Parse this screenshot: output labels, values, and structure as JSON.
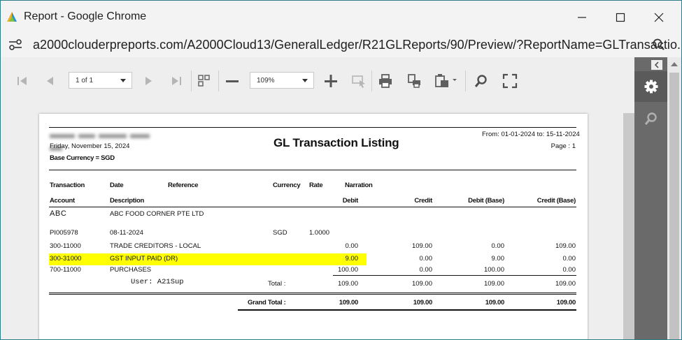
{
  "window": {
    "title": "Report - Google Chrome",
    "url": "a2000clouderpreports.com/A2000Cloud13/GeneralLedger/R21GLReports/90/Preview/?ReportName=GLTransactio..."
  },
  "toolbar": {
    "page_select": "1 of 1",
    "zoom_select": "109%",
    "colors": {
      "icon": "#7a7a7a",
      "disabled_icon": "#b5b5b5"
    }
  },
  "side_panel": {
    "items": [
      {
        "icon": "gear-icon",
        "active": true
      },
      {
        "icon": "search-icon",
        "active": false
      }
    ]
  },
  "report": {
    "title": "GL Transaction Listing",
    "print_date": "Friday, November 15, 2024",
    "base_currency": "Base Currency = SGD",
    "date_range": "From: 01-01-2024 to: 15-11-2024",
    "page": "Page : 1",
    "headers_row1": {
      "transaction": "Transaction",
      "date": "Date",
      "reference": "Reference",
      "currency": "Currency",
      "rate": "Rate",
      "narration": "Narration"
    },
    "headers_row2": {
      "account": "Account",
      "description": "Description",
      "debit": "Debit",
      "credit": "Credit",
      "debit_base": "Debit (Base)",
      "credit_base": "Credit (Base)"
    },
    "group": {
      "code": "ABC",
      "name": "ABC FOOD CORNER PTE LTD"
    },
    "transaction": {
      "number": "PI005978",
      "date": "08-11-2024",
      "currency": "SGD",
      "rate": "1.0000"
    },
    "lines": [
      {
        "account": "300-11000",
        "description": "TRADE CREDITORS - LOCAL",
        "debit": "0.00",
        "credit": "109.00",
        "debit_base": "0.00",
        "credit_base": "109.00",
        "highlight": false
      },
      {
        "account": "300-31000",
        "description": "GST INPUT PAID (DR)",
        "debit": "9.00",
        "credit": "0.00",
        "debit_base": "9.00",
        "credit_base": "0.00",
        "highlight": true
      },
      {
        "account": "700-11000",
        "description": "PURCHASES",
        "debit": "100.00",
        "credit": "0.00",
        "debit_base": "100.00",
        "credit_base": "0.00",
        "highlight": false
      }
    ],
    "user": "User: A21Sup",
    "total": {
      "label": "Total :",
      "debit": "109.00",
      "credit": "109.00",
      "debit_base": "109.00",
      "credit_base": "109.00"
    },
    "grand_total": {
      "label": "Grand Total :",
      "debit": "109.00",
      "credit": "109.00",
      "debit_base": "109.00",
      "credit_base": "109.00"
    },
    "highlight_color": "#ffff00"
  }
}
